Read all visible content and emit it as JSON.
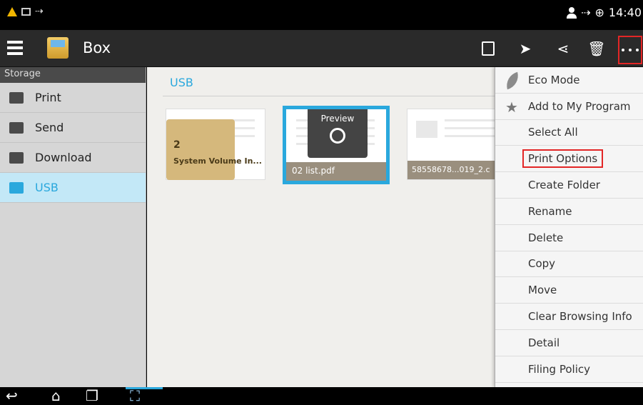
{
  "status": {
    "time": "14:40"
  },
  "app": {
    "title": "Box"
  },
  "sidebar": {
    "header": "Storage",
    "items": [
      {
        "label": "Print",
        "icon": "print-tray-icon"
      },
      {
        "label": "Send",
        "icon": "send-tray-icon"
      },
      {
        "label": "Download",
        "icon": "download-tray-icon"
      },
      {
        "label": "USB",
        "icon": "usb-icon"
      }
    ]
  },
  "main": {
    "breadcrumb": "USB",
    "files": [
      {
        "name": "System Volume In...",
        "count": "2",
        "type": "folder"
      },
      {
        "name": "02 list.pdf",
        "type": "pdf",
        "preview_label": "Preview"
      },
      {
        "name": "58558678...019_2.c",
        "type": "document"
      }
    ]
  },
  "menu": {
    "items": [
      {
        "label": "Eco Mode",
        "icon": "leaf-icon"
      },
      {
        "label": "Add to My Program",
        "icon": "star-plus-icon"
      },
      {
        "label": "Select All"
      },
      {
        "label": "Print Options"
      },
      {
        "label": "Create Folder"
      },
      {
        "label": "Rename"
      },
      {
        "label": "Delete"
      },
      {
        "label": "Copy"
      },
      {
        "label": "Move"
      },
      {
        "label": "Clear Browsing Info"
      },
      {
        "label": "Detail"
      },
      {
        "label": "Filing Policy"
      }
    ]
  },
  "colors": {
    "accent": "#2aa8dd",
    "highlight": "#e32626"
  }
}
